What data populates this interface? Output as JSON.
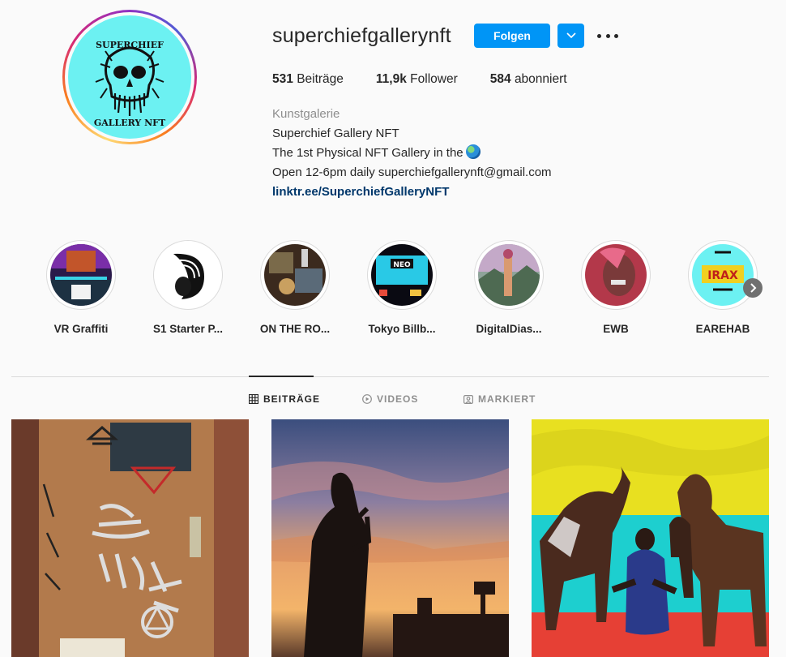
{
  "profile": {
    "username": "superchiefgallerynft",
    "follow_label": "Folgen",
    "avatar_text_top": "SUPERCHIEF",
    "avatar_text_bottom": "GALLERY NFT",
    "stats": {
      "posts_value": "531",
      "posts_label": "Beiträge",
      "followers_value": "11,9k",
      "followers_label": "Follower",
      "following_value": "584",
      "following_label": "abonniert"
    },
    "bio": {
      "category": "Kunstgalerie",
      "name": "Superchief Gallery NFT",
      "line1": "The 1st Physical NFT Gallery in the",
      "line2": "Open 12-6pm daily superchiefgallerynft@gmail.com",
      "link": "linktr.ee/SuperchiefGalleryNFT"
    },
    "colors": {
      "accent": "#0095f6",
      "avatar_bg": "#6cf1f2",
      "link": "#00376b"
    }
  },
  "highlights": [
    {
      "label": "VR Graffiti"
    },
    {
      "label": "S1 Starter P..."
    },
    {
      "label": "ON THE RO..."
    },
    {
      "label": "Tokyo Billb..."
    },
    {
      "label": "DigitalDias..."
    },
    {
      "label": "EWB"
    },
    {
      "label": "EAREHAB"
    }
  ],
  "highlight_thumb_text": {
    "tokyo": "NEO",
    "earehab": "IRAX"
  },
  "tabs": [
    {
      "label": "BEITRÄGE",
      "icon": "grid-icon",
      "active": true
    },
    {
      "label": "VIDEOS",
      "icon": "play-icon",
      "active": false
    },
    {
      "label": "MARKIERT",
      "icon": "tag-icon",
      "active": false
    }
  ],
  "posts": [
    {
      "subject": "graffiti-door"
    },
    {
      "subject": "sunset-silhouette"
    },
    {
      "subject": "horses-beach"
    }
  ]
}
